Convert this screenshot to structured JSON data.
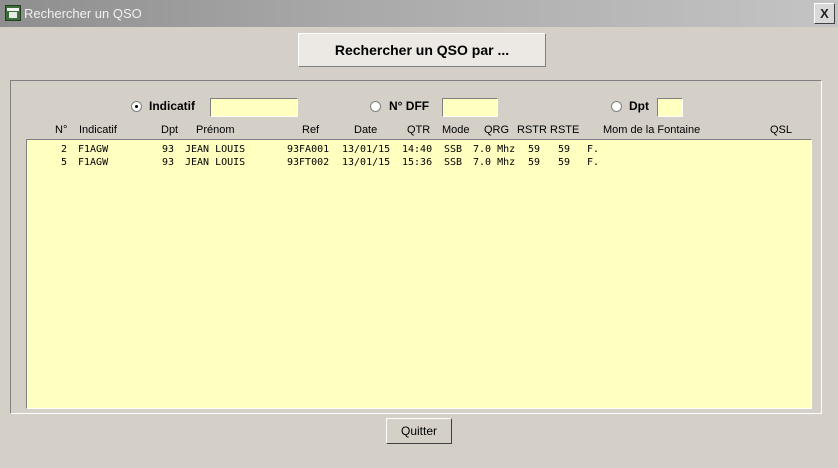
{
  "window": {
    "title": "Rechercher un QSO",
    "close_label": "X"
  },
  "search_button": "Rechercher un QSO par ...",
  "options": [
    {
      "label": "Indicatif",
      "selected": true,
      "value": ""
    },
    {
      "label": "N° DFF",
      "selected": false,
      "value": ""
    },
    {
      "label": "Dpt",
      "selected": false,
      "value": ""
    }
  ],
  "columns": [
    "N°",
    "Indicatif",
    "Dpt",
    "Prénom",
    "Ref",
    "Date",
    "QTR",
    "Mode",
    "QRG",
    "RSTR",
    "RSTE",
    "Mom de la Fontaine",
    "QSL"
  ],
  "rows": [
    {
      "n": "2",
      "indicatif": "F1AGW",
      "dpt": "93",
      "prenom": "JEAN LOUIS",
      "ref": "93FA001",
      "date": "13/01/15",
      "qtr": "14:40",
      "mode": "SSB",
      "qrg": "7.0 Mhz",
      "rstr": "59",
      "rste": "59",
      "fontaine": "F.",
      "qsl": ""
    },
    {
      "n": "5",
      "indicatif": "F1AGW",
      "dpt": "93",
      "prenom": "JEAN LOUIS",
      "ref": "93FT002",
      "date": "13/01/15",
      "qtr": "15:36",
      "mode": "SSB",
      "qrg": "7.0 Mhz",
      "rstr": "59",
      "rste": "59",
      "fontaine": "F.",
      "qsl": ""
    }
  ],
  "quit_button": "Quitter",
  "colors": {
    "list_background": "#ffffc0",
    "dialog_background": "#d4d0c8"
  }
}
